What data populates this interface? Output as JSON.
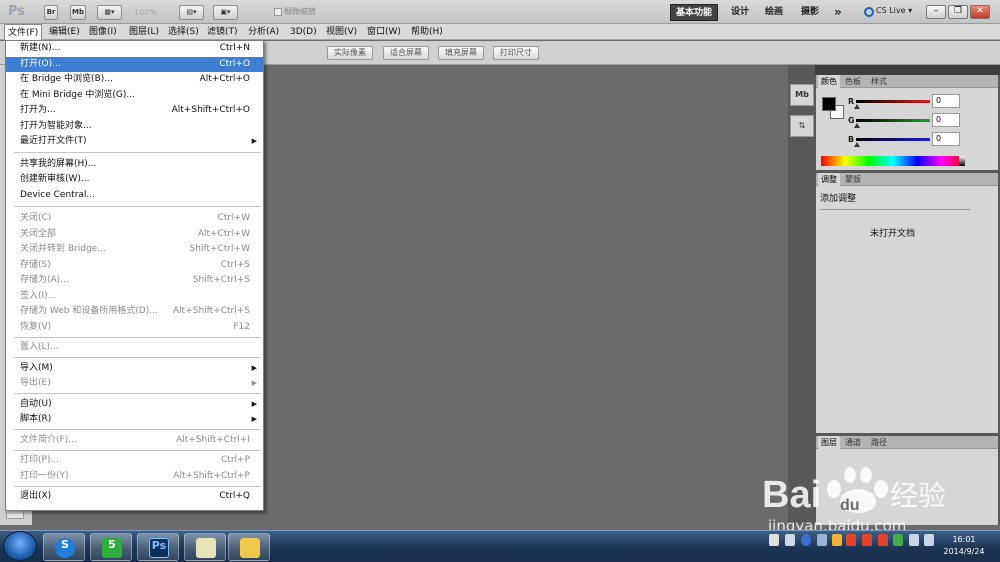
{
  "appbar": {
    "logo": "Ps",
    "btn_br": "Br",
    "btn_mb": "Mb",
    "zoom": "100%",
    "workspaces": [
      {
        "label": "基本功能",
        "active": true
      },
      {
        "label": "设计",
        "active": false
      },
      {
        "label": "绘画",
        "active": false
      },
      {
        "label": "摄影",
        "active": false
      }
    ],
    "more": "»",
    "cslive": "CS Live ▾"
  },
  "menubar": {
    "items": [
      "文件(F)",
      "编辑(E)",
      "图像(I)",
      "图层(L)",
      "选择(S)",
      "滤镜(T)",
      "分析(A)",
      "3D(D)",
      "视图(V)",
      "窗口(W)",
      "帮助(H)"
    ]
  },
  "options": {
    "checkbox_label": "细微缩放",
    "buttons": [
      "实际像素",
      "适合屏幕",
      "填充屏幕",
      "打印尺寸"
    ]
  },
  "file_menu": {
    "items": [
      {
        "label": "新建(N)...",
        "shortcut": "Ctrl+N"
      },
      {
        "label": "打开(O)...",
        "shortcut": "Ctrl+O",
        "highlighted": true
      },
      {
        "label": "在 Bridge 中浏览(B)...",
        "shortcut": "Alt+Ctrl+O"
      },
      {
        "label": "在 Mini Bridge 中浏览(G)...",
        "shortcut": ""
      },
      {
        "label": "打开为...",
        "shortcut": "Alt+Shift+Ctrl+O"
      },
      {
        "label": "打开为智能对象...",
        "shortcut": ""
      },
      {
        "label": "最近打开文件(T)",
        "shortcut": "",
        "submenu": true
      },
      {
        "label": "共享我的屏幕(H)...",
        "shortcut": ""
      },
      {
        "label": "创建新审核(W)...",
        "shortcut": ""
      },
      {
        "label": "Device Central...",
        "shortcut": ""
      },
      {
        "label": "关闭(C)",
        "shortcut": "Ctrl+W",
        "disabled": true
      },
      {
        "label": "关闭全部",
        "shortcut": "Alt+Ctrl+W",
        "disabled": true
      },
      {
        "label": "关闭并转到 Bridge...",
        "shortcut": "Shift+Ctrl+W",
        "disabled": true
      },
      {
        "label": "存储(S)",
        "shortcut": "Ctrl+S",
        "disabled": true
      },
      {
        "label": "存储为(A)...",
        "shortcut": "Shift+Ctrl+S",
        "disabled": true
      },
      {
        "label": "签入(I)...",
        "shortcut": "",
        "disabled": true
      },
      {
        "label": "存储为 Web 和设备所用格式(D)...",
        "shortcut": "Alt+Shift+Ctrl+S",
        "disabled": true
      },
      {
        "label": "恢复(V)",
        "shortcut": "F12",
        "disabled": true
      },
      {
        "label": "置入(L)...",
        "shortcut": "",
        "disabled": true
      },
      {
        "label": "导入(M)",
        "shortcut": "",
        "submenu": true
      },
      {
        "label": "导出(E)",
        "shortcut": "",
        "submenu": true,
        "disabled": true
      },
      {
        "label": "自动(U)",
        "shortcut": "",
        "submenu": true
      },
      {
        "label": "脚本(R)",
        "shortcut": "",
        "submenu": true
      },
      {
        "label": "文件简介(F)...",
        "shortcut": "Alt+Shift+Ctrl+I",
        "disabled": true
      },
      {
        "label": "打印(P)...",
        "shortcut": "Ctrl+P",
        "disabled": true
      },
      {
        "label": "打印一份(Y)",
        "shortcut": "Alt+Shift+Ctrl+P",
        "disabled": true
      },
      {
        "label": "退出(X)",
        "shortcut": "Ctrl+Q"
      }
    ]
  },
  "color_panel": {
    "tabs": [
      "颜色",
      "色板",
      "样式"
    ],
    "channels": [
      {
        "label": "R",
        "value": "0",
        "color": "#d22020"
      },
      {
        "label": "G",
        "value": "0",
        "color": "#1fa51f"
      },
      {
        "label": "B",
        "value": "0",
        "color": "#2020d2"
      }
    ]
  },
  "adjust_panel": {
    "tabs": [
      "调整",
      "蒙版"
    ],
    "title": "添加调整",
    "message": "未打开文档"
  },
  "layers_panel": {
    "tabs": [
      "图层",
      "通道",
      "路径"
    ]
  },
  "dock": {
    "icon_mb": "Mb"
  },
  "taskbar": {
    "time": "16:01",
    "date": "2014/9/24",
    "app_ps": "Ps"
  },
  "watermark": {
    "brand": "Bai",
    "brand2": "du",
    "brand_cn": "经验",
    "url": "jingyan.baidu.com"
  }
}
